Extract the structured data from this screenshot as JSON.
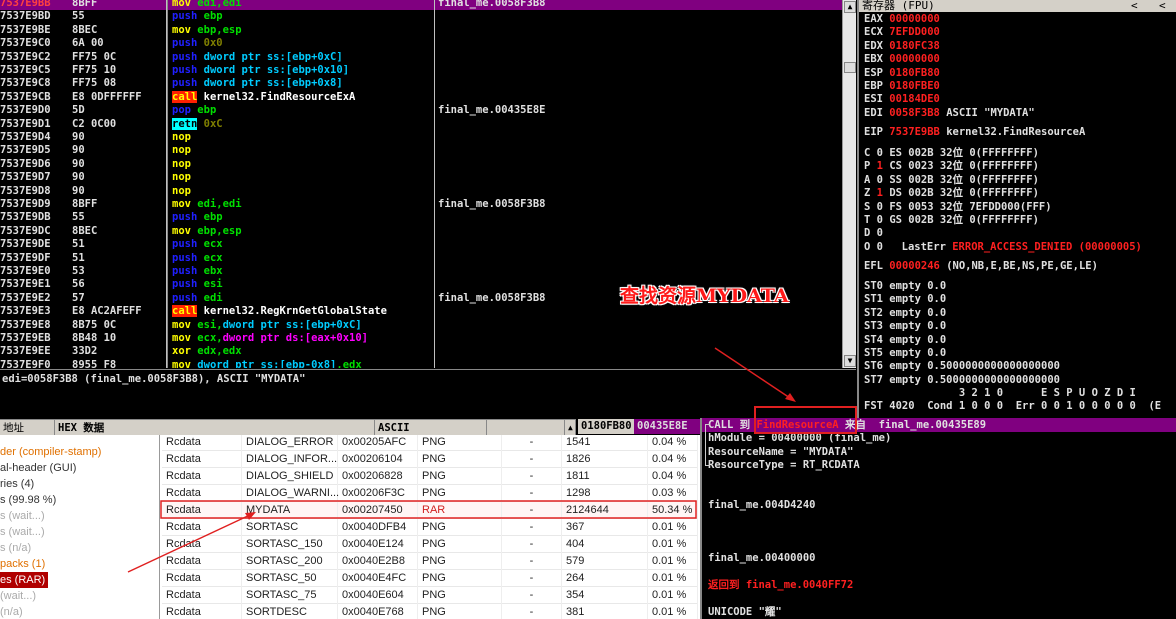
{
  "disasm": {
    "rows": [
      {
        "addr": "7537E9BB",
        "hex": "8BFF",
        "op": "mov",
        "ops": [
          [
            "edi,edi",
            "reg"
          ]
        ],
        "cmt": "final_me.0058F3B8",
        "selected": true
      },
      {
        "addr": "7537E9BD",
        "hex": "55",
        "op": "push",
        "ops": [
          [
            "ebp",
            "reg"
          ]
        ],
        "cmt": ""
      },
      {
        "addr": "7537E9BE",
        "hex": "8BEC",
        "op": "mov",
        "ops": [
          [
            "ebp,esp",
            "reg"
          ]
        ],
        "cmt": ""
      },
      {
        "addr": "7537E9C0",
        "hex": "6A 00",
        "op": "push",
        "ops": [
          [
            "0x0",
            "imm"
          ]
        ],
        "cmt": ""
      },
      {
        "addr": "7537E9C2",
        "hex": "FF75 0C",
        "op": "push",
        "ops": [
          [
            "dword ptr ss:[ebp+0xC]",
            "mem"
          ]
        ],
        "cmt": ""
      },
      {
        "addr": "7537E9C5",
        "hex": "FF75 10",
        "op": "push",
        "ops": [
          [
            "dword ptr ss:[ebp+0x10]",
            "mem"
          ]
        ],
        "cmt": ""
      },
      {
        "addr": "7537E9C8",
        "hex": "FF75 08",
        "op": "push",
        "ops": [
          [
            "dword ptr ss:[ebp+0x8]",
            "mem"
          ]
        ],
        "cmt": ""
      },
      {
        "addr": "7537E9CB",
        "hex": "E8 0DFFFFFF",
        "op": "call",
        "ops": [
          [
            "kernel32.FindResourceExA",
            "sym"
          ]
        ],
        "cmt": ""
      },
      {
        "addr": "7537E9D0",
        "hex": "5D",
        "op": "pop",
        "ops": [
          [
            "ebp",
            "reg"
          ]
        ],
        "cmt": "final_me.00435E8E"
      },
      {
        "addr": "7537E9D1",
        "hex": "C2 0C00",
        "op": "retn",
        "ops": [
          [
            "0xC",
            "imm"
          ]
        ],
        "cmt": ""
      },
      {
        "addr": "7537E9D4",
        "hex": "90",
        "op": "nop",
        "ops": [],
        "cmt": ""
      },
      {
        "addr": "7537E9D5",
        "hex": "90",
        "op": "nop",
        "ops": [],
        "cmt": ""
      },
      {
        "addr": "7537E9D6",
        "hex": "90",
        "op": "nop",
        "ops": [],
        "cmt": ""
      },
      {
        "addr": "7537E9D7",
        "hex": "90",
        "op": "nop",
        "ops": [],
        "cmt": ""
      },
      {
        "addr": "7537E9D8",
        "hex": "90",
        "op": "nop",
        "ops": [],
        "cmt": ""
      },
      {
        "addr": "7537E9D9",
        "hex": "8BFF",
        "op": "mov",
        "ops": [
          [
            "edi,edi",
            "reg"
          ]
        ],
        "cmt": "final_me.0058F3B8"
      },
      {
        "addr": "7537E9DB",
        "hex": "55",
        "op": "push",
        "ops": [
          [
            "ebp",
            "reg"
          ]
        ],
        "cmt": ""
      },
      {
        "addr": "7537E9DC",
        "hex": "8BEC",
        "op": "mov",
        "ops": [
          [
            "ebp,esp",
            "reg"
          ]
        ],
        "cmt": ""
      },
      {
        "addr": "7537E9DE",
        "hex": "51",
        "op": "push",
        "ops": [
          [
            "ecx",
            "reg"
          ]
        ],
        "cmt": ""
      },
      {
        "addr": "7537E9DF",
        "hex": "51",
        "op": "push",
        "ops": [
          [
            "ecx",
            "reg"
          ]
        ],
        "cmt": ""
      },
      {
        "addr": "7537E9E0",
        "hex": "53",
        "op": "push",
        "ops": [
          [
            "ebx",
            "reg"
          ]
        ],
        "cmt": ""
      },
      {
        "addr": "7537E9E1",
        "hex": "56",
        "op": "push",
        "ops": [
          [
            "esi",
            "reg"
          ]
        ],
        "cmt": ""
      },
      {
        "addr": "7537E9E2",
        "hex": "57",
        "op": "push",
        "ops": [
          [
            "edi",
            "reg"
          ]
        ],
        "cmt": "final_me.0058F3B8"
      },
      {
        "addr": "7537E9E3",
        "hex": "E8 AC2AFEFF",
        "op": "call",
        "ops": [
          [
            "kernel32.RegKrnGetGlobalState",
            "sym"
          ]
        ],
        "cmt": ""
      },
      {
        "addr": "7537E9E8",
        "hex": "8B75 0C",
        "op": "mov",
        "ops": [
          [
            "esi,",
            "reg"
          ],
          [
            "dword ptr ss:[ebp+0xC]",
            "mem"
          ]
        ],
        "cmt": ""
      },
      {
        "addr": "7537E9EB",
        "hex": "8B48 10",
        "op": "mov",
        "ops": [
          [
            "ecx,",
            "reg"
          ],
          [
            "dword ptr ds:[eax+0x10]",
            "ds"
          ]
        ],
        "cmt": ""
      },
      {
        "addr": "7537E9EE",
        "hex": "33D2",
        "op": "xor",
        "ops": [
          [
            "edx,edx",
            "reg"
          ]
        ],
        "cmt": ""
      },
      {
        "addr": "7537E9F0",
        "hex": "8955 F8",
        "op": "mov",
        "ops": [
          [
            "dword ptr ss:[ebp-0x8]",
            "mem"
          ],
          [
            ",edx",
            "reg"
          ]
        ],
        "cmt": ""
      }
    ]
  },
  "info_line": "edi=0058F3B8 (final_me.0058F3B8), ASCII \"MYDATA\"",
  "registers": {
    "title": "寄存器 (FPU)",
    "nav": [
      "<",
      "<"
    ],
    "gpr": [
      {
        "name": "EAX",
        "val": "00000000",
        "note": ""
      },
      {
        "name": "ECX",
        "val": "7EFDD000",
        "note": ""
      },
      {
        "name": "EDX",
        "val": "0180FC38",
        "note": ""
      },
      {
        "name": "EBX",
        "val": "00000000",
        "note": ""
      },
      {
        "name": "ESP",
        "val": "0180FB80",
        "note": ""
      },
      {
        "name": "EBP",
        "val": "0180FBE0",
        "note": ""
      },
      {
        "name": "ESI",
        "val": "00184DE0",
        "note": ""
      },
      {
        "name": "EDI",
        "val": "0058F3B8",
        "note": "ASCII \"MYDATA\""
      }
    ],
    "eip": {
      "name": "EIP",
      "val": "7537E9BB",
      "note": "kernel32.FindResourceA"
    },
    "flags": [
      {
        "f": "C",
        "v": "0",
        "seg": "ES 002B 32位 0(FFFFFFFF)",
        "red": false
      },
      {
        "f": "P",
        "v": "1",
        "seg": "CS 0023 32位 0(FFFFFFFF)",
        "red": true
      },
      {
        "f": "A",
        "v": "0",
        "seg": "SS 002B 32位 0(FFFFFFFF)",
        "red": false
      },
      {
        "f": "Z",
        "v": "1",
        "seg": "DS 002B 32位 0(FFFFFFFF)",
        "red": true
      },
      {
        "f": "S",
        "v": "0",
        "seg": "FS 0053 32位 7EFDD000(FFF)",
        "red": false
      },
      {
        "f": "T",
        "v": "0",
        "seg": "GS 002B 32位 0(FFFFFFFF)",
        "red": false
      },
      {
        "f": "D",
        "v": "0",
        "seg": "",
        "red": false
      },
      {
        "f": "O",
        "v": "0",
        "seg": "",
        "red": false
      }
    ],
    "lasterr_label": "LastErr",
    "lasterr": "ERROR_ACCESS_DENIED (00000005)",
    "efl_label": "EFL",
    "efl": "00000246",
    "efl_note": "(NO,NB,E,BE,NS,PE,GE,LE)",
    "st": [
      "ST0 empty 0.0",
      "ST1 empty 0.0",
      "ST2 empty 0.0",
      "ST3 empty 0.0",
      "ST4 empty 0.0",
      "ST5 empty 0.0",
      "ST6 empty 0.5000000000000000000",
      "ST7 empty 0.5000000000000000000"
    ],
    "fst_hdr": "               3 2 1 0      E S P U O Z D I",
    "fst": "FST 4020  Cond 1 0 0 0  Err 0 0 1 0 0 0 0 0  (E"
  },
  "dump": {
    "headers": [
      "地址",
      "HEX 数据",
      "ASCII",
      ""
    ],
    "stack_headers": [
      "0180FB80",
      "00435E8E"
    ]
  },
  "pe_tool": {
    "tree": [
      {
        "label": "der (compiler-stamp)",
        "style": "orange"
      },
      {
        "label": "al-header (GUI)",
        "style": ""
      },
      {
        "label": "ries (4)",
        "style": ""
      },
      {
        "label": "s (99.98 %)",
        "style": ""
      },
      {
        "label": "s (wait...)",
        "style": "grey"
      },
      {
        "label": "s (wait...)",
        "style": "grey"
      },
      {
        "label": "s (n/a)",
        "style": "grey"
      },
      {
        "label": "packs (1)",
        "style": "orange"
      },
      {
        "label": "es (RAR)",
        "style": "sel"
      },
      {
        "label": "(wait...)",
        "style": "grey"
      },
      {
        "label": "(n/a)",
        "style": "grey"
      }
    ],
    "rows": [
      [
        "Rcdata",
        "DIALOG_ERROR",
        "0x00205AFC",
        "PNG",
        "-",
        "1541",
        "0.04 %"
      ],
      [
        "Rcdata",
        "DIALOG_INFOR...",
        "0x00206104",
        "PNG",
        "-",
        "1826",
        "0.04 %"
      ],
      [
        "Rcdata",
        "DIALOG_SHIELD",
        "0x00206828",
        "PNG",
        "-",
        "1811",
        "0.04 %"
      ],
      [
        "Rcdata",
        "DIALOG_WARNI...",
        "0x00206F3C",
        "PNG",
        "-",
        "1298",
        "0.03 %"
      ],
      [
        "Rcdata",
        "MYDATA",
        "0x00207450",
        "RAR",
        "-",
        "2124644",
        "50.34 %"
      ],
      [
        "Rcdata",
        "SORTASC",
        "0x0040DFB4",
        "PNG",
        "-",
        "367",
        "0.01 %"
      ],
      [
        "Rcdata",
        "SORTASC_150",
        "0x0040E124",
        "PNG",
        "-",
        "404",
        "0.01 %"
      ],
      [
        "Rcdata",
        "SORTASC_200",
        "0x0040E2B8",
        "PNG",
        "-",
        "579",
        "0.01 %"
      ],
      [
        "Rcdata",
        "SORTASC_50",
        "0x0040E4FC",
        "PNG",
        "-",
        "264",
        "0.01 %"
      ],
      [
        "Rcdata",
        "SORTASC_75",
        "0x0040E604",
        "PNG",
        "-",
        "354",
        "0.01 %"
      ],
      [
        "Rcdata",
        "SORTDESC",
        "0x0040E768",
        "PNG",
        "-",
        "381",
        "0.01 %"
      ]
    ]
  },
  "stack_comments": {
    "call_prefix": "CALL 到",
    "call_target": "FindResourceA",
    "call_from": "来自  final_me.00435E89",
    "params": [
      "hModule = 00400000 (final_me)",
      "ResourceName = \"MYDATA\"",
      "ResourceType = RT_RCDATA"
    ],
    "c1": "final_me.004D4240",
    "c2": "final_me.00400000",
    "return_prefix": "返回到",
    "return_target": "final_me.0040FF72",
    "unicode": "UNICODE \"耀\""
  },
  "annotation": "查找资源MYDATA",
  "colors": {
    "selection": "#800080",
    "highlight_box": "#e02020"
  }
}
